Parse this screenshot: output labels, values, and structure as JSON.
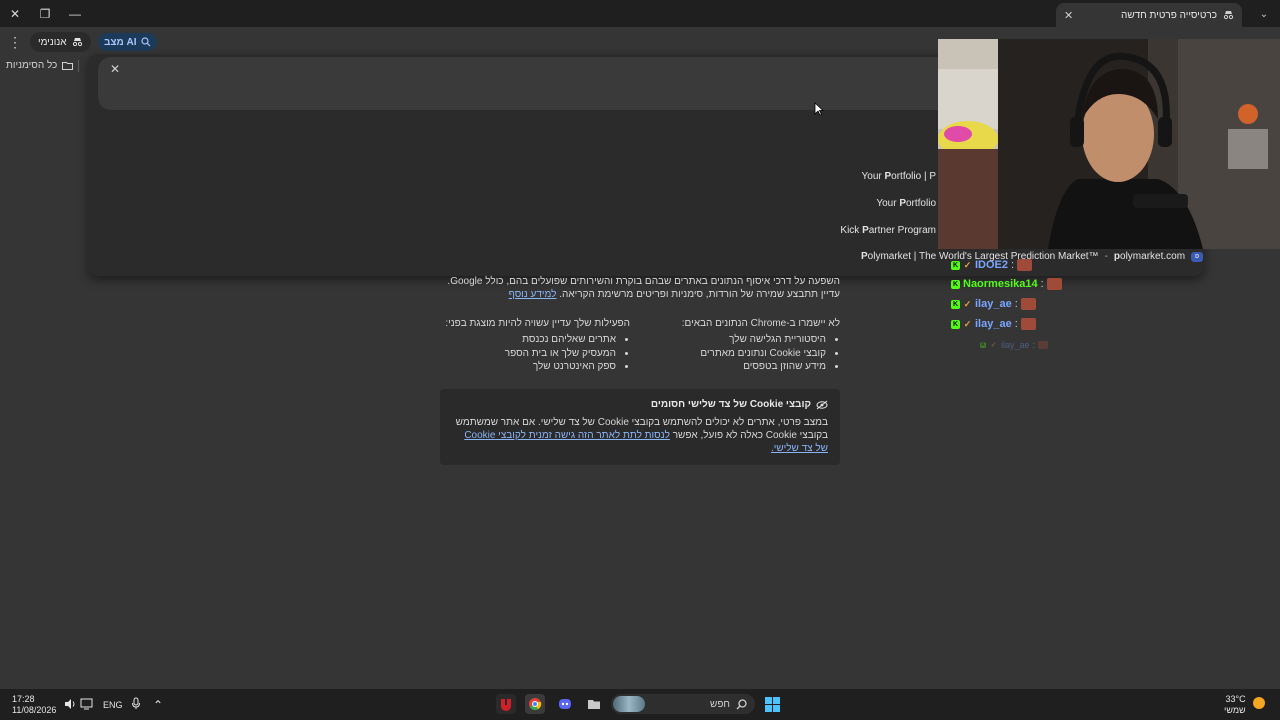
{
  "titlebar": {
    "tab_title": "כרטיסייה פרטית חדשה",
    "tab_close": "✕",
    "new_tab": "+",
    "tab_menu": "⌄",
    "minimize": "—",
    "restore": "❐",
    "close": "✕"
  },
  "toolbar": {
    "incognito_label": "אנונימי",
    "ai_mode_label": "מצב AI",
    "menu_icon": "⋮",
    "bookmarks_all": "כל הסימניות"
  },
  "omnibox": {
    "clear": "✕",
    "suggestions": [
      {
        "prefix": "Your ",
        "bold": "P",
        "rest": "ortfolio | P"
      },
      {
        "prefix": "Your ",
        "bold": "P",
        "rest": "ortfolio"
      },
      {
        "prefix": "Kick ",
        "bold": "P",
        "rest": "artner Program"
      }
    ],
    "suggestion_4": {
      "bold": "P",
      "rest": "olymarket | The World's Largest Prediction Market™",
      "sep": "-",
      "domain_bold": "p",
      "domain_rest": "olymarket.com",
      "badge": "ᴅ"
    }
  },
  "incognito_page": {
    "intro": "השפעה על דרכי איסוף הנתונים באתרים שבהם בוקרת והשירותים שפועלים בהם, כולל Google. עדיין תתבצע שמירה של הורדות, סימניות ופריטים מרשימת הקריאה.",
    "learn_more": "למידע נוסף",
    "col_right_title": "לא יישמרו ב-Chrome הנתונים הבאים:",
    "col_right_items": [
      "היסטוריית הגלישה שלך",
      "קובצי Cookie ונתונים מאתרים",
      "מידע שהוזן בטפסים"
    ],
    "col_left_title": "הפעילות שלך עדיין עשויה להיות מוצגת בפני:",
    "col_left_items": [
      "אתרים שאליהם נכנסת",
      "המעסיק שלך או בית הספר",
      "ספק האינטרנט שלך"
    ],
    "cookie_title": "קובצי Cookie של צד שלישי חסומים",
    "cookie_body": "במצב פרטי, אתרים לא יכולים להשתמש בקובצי Cookie של צד שלישי. אם אתר שמשתמש בקובצי Cookie כאלה לא פועל, אפשר",
    "cookie_link": "לנסות לתת לאתר הזה גישה זמנית לקובצי Cookie של צד שלישי."
  },
  "chat": {
    "lines": [
      {
        "user": "IDOE2",
        "color": "#7aa6ff"
      },
      {
        "user": "Naormesika14",
        "color": "#53fc18"
      },
      {
        "user": "ilay_ae",
        "color": "#7aa6ff"
      },
      {
        "user": "ilay_ae",
        "color": "#7aa6ff"
      },
      {
        "user": "ilay_ae",
        "color": "#7aa6ff"
      }
    ],
    "colon": ":"
  },
  "taskbar": {
    "time": "17:28",
    "date": "11/08/2026",
    "lang": "ENG",
    "search_label": "חפש",
    "weather_temp": "33°C",
    "weather_desc": "שמשי",
    "chevron": "⌃"
  },
  "colors": {
    "accent_blue": "#8ab4f8",
    "kick_green": "#53fc18"
  }
}
